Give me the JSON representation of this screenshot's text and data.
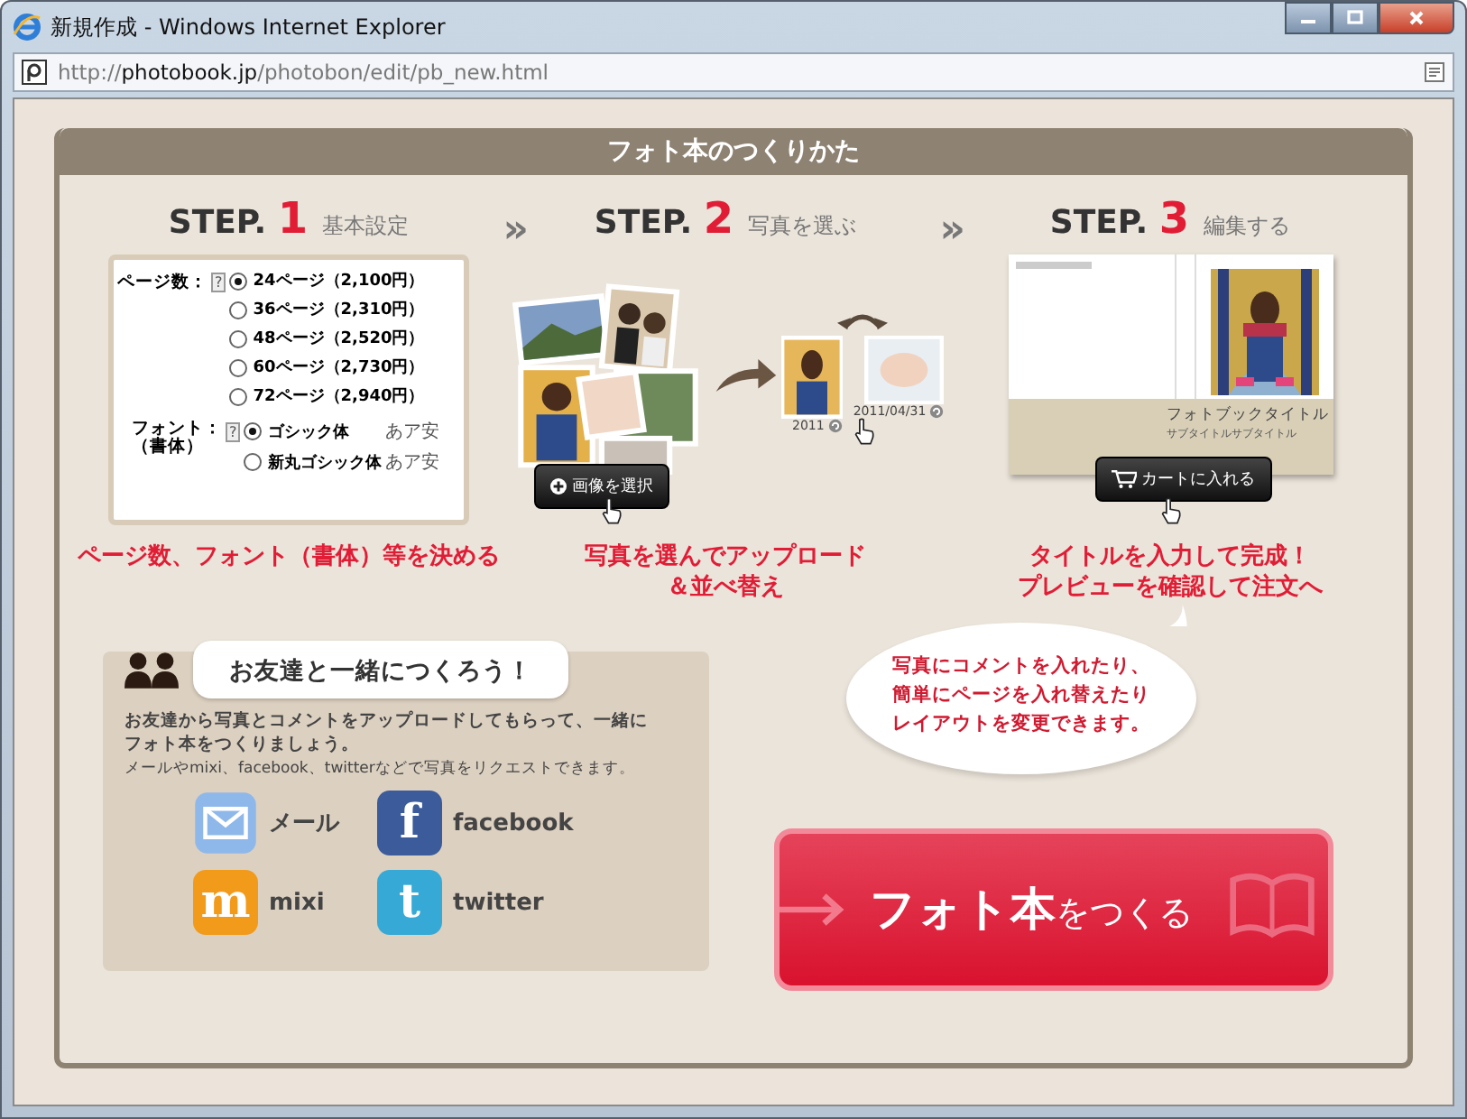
{
  "window": {
    "title": "新規作成 - Windows Internet Explorer"
  },
  "address_bar": {
    "scheme": "http://",
    "host": "photobook.jp",
    "path": "/photobon/edit/pb_new.html"
  },
  "guide": {
    "title": "フォト本のつくりかた",
    "steps": [
      {
        "label": "STEP.",
        "number": "1",
        "name": "基本設定",
        "caption": [
          "ページ数、フォント（書体）等を決める"
        ]
      },
      {
        "label": "STEP.",
        "number": "2",
        "name": "写真を選ぶ",
        "caption": [
          "写真を選んでアップロード",
          "＆並べ替え"
        ]
      },
      {
        "label": "STEP.",
        "number": "3",
        "name": "編集する",
        "caption": [
          "タイトルを入力して完成！",
          "プレビューを確認して注文へ"
        ]
      }
    ],
    "separator": "»",
    "settings_form": {
      "page_label": "ページ数：",
      "help": "?",
      "pages": [
        {
          "label": "24ページ（2,100円）",
          "selected": true
        },
        {
          "label": "36ページ（2,310円）",
          "selected": false
        },
        {
          "label": "48ページ（2,520円）",
          "selected": false
        },
        {
          "label": "60ページ（2,730円）",
          "selected": false
        },
        {
          "label": "72ページ（2,940円）",
          "selected": false
        }
      ],
      "font_label": [
        "フォント：",
        "（書体）"
      ],
      "fonts": [
        {
          "label": "ゴシック体",
          "sample": "あア安",
          "selected": true
        },
        {
          "label": "新丸ゴシック体",
          "sample": "あア安",
          "selected": false
        }
      ]
    },
    "photo_step": {
      "select_button": "画像を選択",
      "thumbs": [
        {
          "date": "2011"
        },
        {
          "date": "2011/04/31"
        }
      ]
    },
    "edit_step": {
      "book_title": "フォトブックタイトル",
      "book_subtitle": "サブタイトルサブタイトル",
      "cart_button": "カートに入れる"
    }
  },
  "friends": {
    "heading": "お友達と一緒につくろう！",
    "text": [
      "お友達から写真とコメントをアップロードしてもらって、一緒に",
      "フォト本をつくりましょう。"
    ],
    "note": "メールやmixi、facebook、twitterなどで写真をリクエストできます。",
    "services": [
      {
        "kind": "mail",
        "label": "メール"
      },
      {
        "kind": "facebook",
        "label": "facebook",
        "glyph": "f"
      },
      {
        "kind": "mixi",
        "label": "mixi",
        "glyph": "m"
      },
      {
        "kind": "twitter",
        "label": "twitter",
        "glyph": "t"
      }
    ]
  },
  "tip_bubble": {
    "lines": [
      "写真にコメントを入れたり、",
      "簡単にページを入れ替えたり",
      "レイアウトを変更できます。"
    ]
  },
  "create_button": {
    "label": "**フォト本**をつくる"
  }
}
